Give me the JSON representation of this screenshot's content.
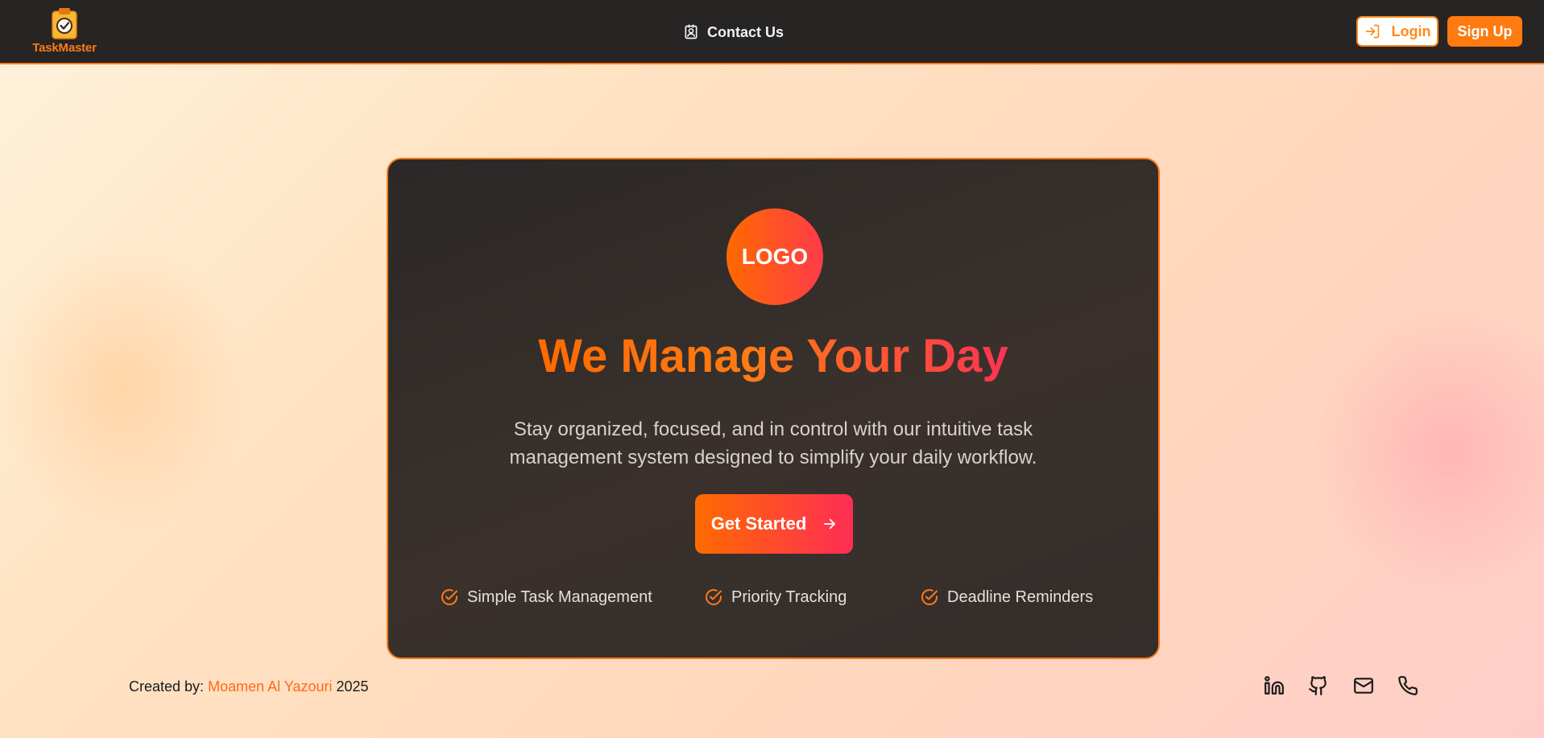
{
  "brand": {
    "name": "TaskMaster",
    "icon": "clipboard-check-icon"
  },
  "nav": {
    "contact_label": "Contact Us",
    "contact_icon": "contact-icon",
    "login_label": "Login",
    "login_icon": "login-icon",
    "signup_label": "Sign Up"
  },
  "hero": {
    "logo_text": "LOGO",
    "title": "We Manage Your Day",
    "subtitle": "Stay organized, focused, and in control with our intuitive task management system designed to simplify your daily workflow.",
    "cta_label": "Get Started",
    "cta_icon": "arrow-right-icon",
    "features": [
      {
        "label": "Simple Task Management",
        "icon": "check-circle-icon"
      },
      {
        "label": "Priority Tracking",
        "icon": "check-circle-icon"
      },
      {
        "label": "Deadline Reminders",
        "icon": "check-circle-icon"
      }
    ]
  },
  "footer": {
    "created_by_prefix": "Created by:",
    "author": "Moamen Al Yazouri",
    "year": "2025",
    "social": [
      {
        "name": "linkedin-icon"
      },
      {
        "name": "github-icon"
      },
      {
        "name": "mail-icon"
      },
      {
        "name": "phone-icon"
      }
    ]
  },
  "colors": {
    "accent": "#ff7a1a",
    "gradient_start": "#ff6a00",
    "gradient_end": "#ff2d55",
    "navbar_bg": "#272424",
    "card_bg": "#332d2b"
  }
}
